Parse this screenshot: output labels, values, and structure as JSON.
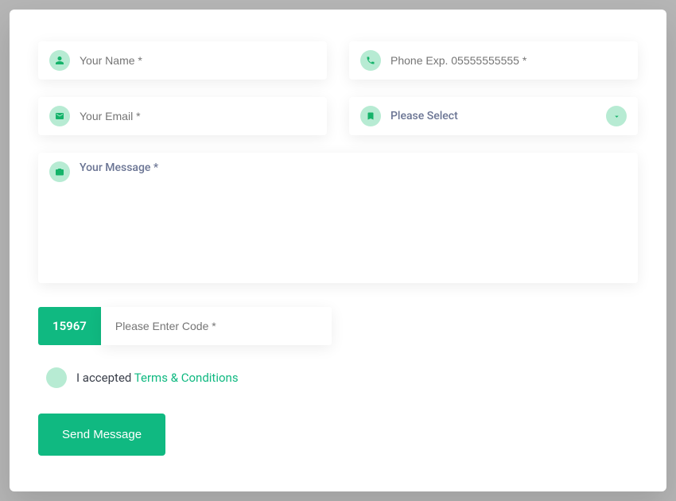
{
  "form": {
    "name_placeholder": "Your Name *",
    "phone_placeholder": "Phone Exp. 05555555555 *",
    "email_placeholder": "Your Email *",
    "select_placeholder": "Please Select",
    "message_placeholder": "Your Message *",
    "captcha_code": "15967",
    "captcha_placeholder": "Please Enter Code *",
    "consent_prefix": "I accepted ",
    "consent_link": "Terms & Conditions",
    "submit_label": "Send Message"
  },
  "icons": {
    "name": "person-icon",
    "phone": "phone-icon",
    "email": "mail-icon",
    "select": "bookmark-icon",
    "message": "camera-icon",
    "chevron": "chevron-down-icon"
  },
  "colors": {
    "accent": "#10b981",
    "accent_light": "#b7ebd3",
    "placeholder": "#6b7594"
  }
}
